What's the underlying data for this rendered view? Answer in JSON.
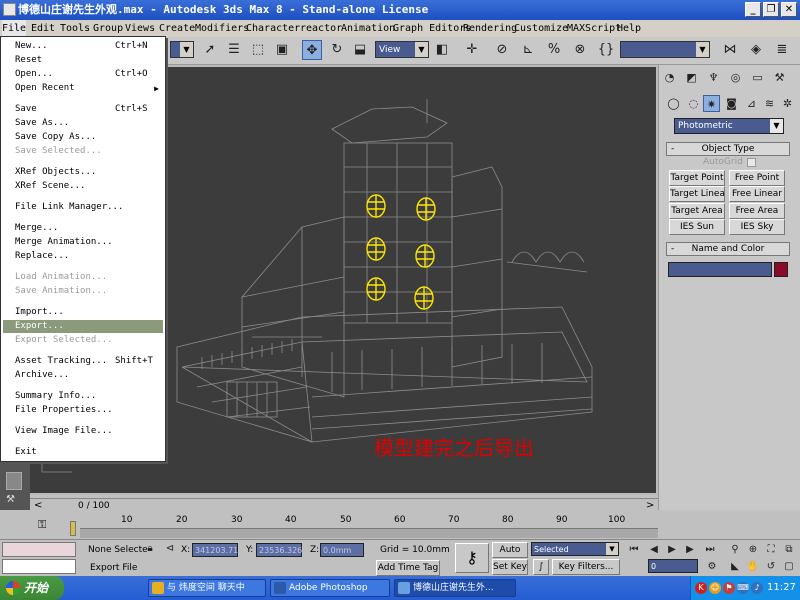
{
  "window": {
    "title": "博德山庄谢先生外观.max - Autodesk 3ds Max 8 - Stand-alone License",
    "minimize_label": "_",
    "restore_label": "❐",
    "close_label": "✕"
  },
  "menubar": {
    "items": [
      "File",
      "Edit",
      "Tools",
      "Group",
      "Views",
      "Create",
      "Modifiers",
      "Character",
      "reactor",
      "Animation",
      "Graph Editors",
      "Rendering",
      "Customize",
      "MAXScript",
      "Help"
    ]
  },
  "toolbar": {
    "view_combo": "View",
    "active_tool": "select-and-move-icon"
  },
  "file_menu": {
    "items": [
      {
        "label": "New...",
        "shortcut": "Ctrl+N"
      },
      {
        "label": "Reset"
      },
      {
        "label": "Open...",
        "shortcut": "Ctrl+O"
      },
      {
        "label": "Open Recent",
        "submenu": "▶"
      },
      {
        "label": "Save",
        "shortcut": "Ctrl+S"
      },
      {
        "label": "Save As..."
      },
      {
        "label": "Save Copy As..."
      },
      {
        "label": "Save Selected...",
        "disabled": true
      },
      {
        "label": "XRef Objects..."
      },
      {
        "label": "XRef Scene..."
      },
      {
        "label": "File Link Manager..."
      },
      {
        "label": "Merge..."
      },
      {
        "label": "Merge Animation..."
      },
      {
        "label": "Replace..."
      },
      {
        "label": "Load Animation...",
        "disabled": true
      },
      {
        "label": "Save Animation...",
        "disabled": true
      },
      {
        "label": "Import..."
      },
      {
        "label": "Export...",
        "highlighted": true
      },
      {
        "label": "Export Selected...",
        "disabled": true
      },
      {
        "label": "Asset Tracking...",
        "shortcut": "Shift+T"
      },
      {
        "label": "Archive..."
      },
      {
        "label": "Summary Info..."
      },
      {
        "label": "File Properties..."
      },
      {
        "label": "View Image File..."
      },
      {
        "label": "Exit"
      }
    ]
  },
  "viewport": {
    "caption": "模型建完之后导出",
    "caption_color": "#e00000",
    "light_color": "#ffe600"
  },
  "command_panel": {
    "category_dropdown": "Photometric",
    "object_type_title": "Object Type",
    "autogrid_label": "AutoGrid",
    "buttons": [
      "Target Point",
      "Free Point",
      "Target Linear",
      "Free Linear",
      "Target Area",
      "Free Area",
      "IES Sun",
      "IES Sky"
    ],
    "name_color_title": "Name and Color",
    "name_value": "",
    "object_color": "#8b0a2a"
  },
  "timeline": {
    "frame_label": "0 / 100",
    "ticks": [
      "10",
      "20",
      "30",
      "40",
      "50",
      "60",
      "70",
      "80",
      "90",
      "100"
    ]
  },
  "statusbar": {
    "selection": "None Selecte",
    "x_label": "X:",
    "x_value": "341203.71",
    "y_label": "Y:",
    "y_value": "23536.326",
    "z_label": "Z:",
    "z_value": "0.0mm",
    "grid": "Grid = 10.0mm",
    "add_time_tag": "Add Time Tag",
    "auto_key": "Auto Key",
    "set_key": "Set Key",
    "key_filter_combo": "Selected",
    "key_filters": "Key Filters...",
    "frame_field": "0",
    "prompt": "Export File"
  },
  "taskbar": {
    "start": "开始",
    "tasks": [
      {
        "label": "与 炜度空间 聊天中",
        "color": "#e8b020"
      },
      {
        "label": "Adobe Photoshop",
        "color": "#2a5aa8"
      },
      {
        "label": "博德山庄谢先生外...",
        "color": "#6aa0e0",
        "active": true
      }
    ],
    "clock": "11:27"
  }
}
